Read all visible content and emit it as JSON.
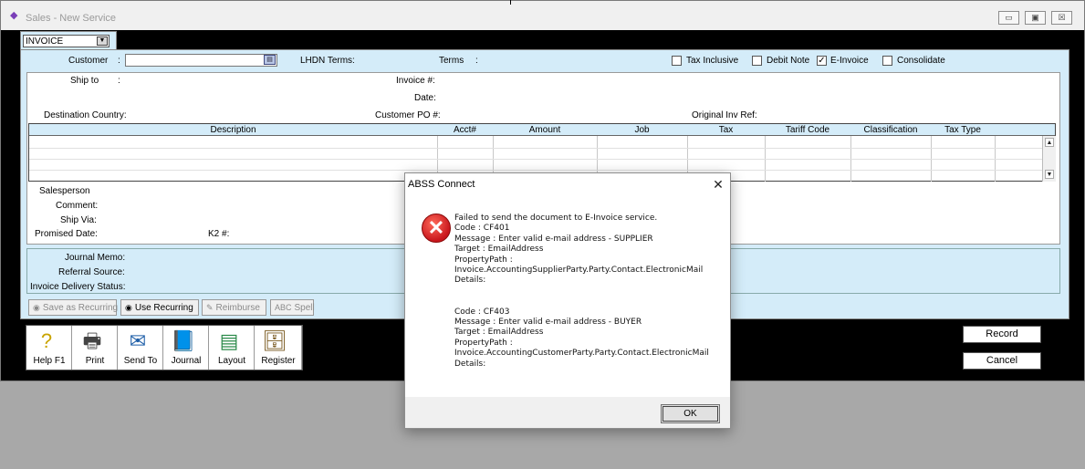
{
  "window": {
    "title": "Sales - New Service",
    "minimize": "▭",
    "maximize": "▣",
    "close": "☒"
  },
  "invoice_type": {
    "value": "INVOICE",
    "arrow": "▼"
  },
  "header": {
    "customer_label": "Customer",
    "colon": ":",
    "customer_value": "",
    "lhdn_terms_label": "LHDN Terms:",
    "terms_label": "Terms",
    "checkboxes": [
      {
        "label": "Tax Inclusive",
        "checked": false
      },
      {
        "label": "Debit Note",
        "checked": false
      },
      {
        "label": "E-Invoice",
        "checked": true
      },
      {
        "label": "Consolidate",
        "checked": false
      }
    ],
    "check_mark": "✓"
  },
  "fields": {
    "ship_to": "Ship to",
    "invoice_no": "Invoice #:",
    "date": "Date:",
    "destination_country": "Destination Country:",
    "customer_po": "Customer PO #:",
    "original_inv_ref": "Original Inv Ref:"
  },
  "grid": {
    "columns": [
      "Description",
      "Acct#",
      "Amount",
      "Job",
      "Tax",
      "Tariff Code",
      "Classification",
      "Tax Type"
    ],
    "scroll_up": "▲",
    "scroll_down": "▼"
  },
  "details": {
    "salesperson": "Salesperson",
    "comment": "Comment:",
    "ship_via": "Ship Via:",
    "promised_date": "Promised Date:",
    "k2": "K2 #:",
    "journal_memo": "Journal Memo:",
    "referral_source": "Referral Source:",
    "delivery_status": "Invoice Delivery Status:"
  },
  "action_buttons": [
    {
      "label": "Save as Recurring",
      "icon": "◉",
      "enabled": false
    },
    {
      "label": "Use Recurring",
      "icon": "◉",
      "enabled": true
    },
    {
      "label": "Reimburse",
      "icon": "✎",
      "enabled": false
    },
    {
      "label": "Spell",
      "icon": "ABC",
      "enabled": false
    }
  ],
  "toolbar": [
    {
      "label": "Help F1",
      "icon": "?",
      "icon_name": "help-icon"
    },
    {
      "label": "Print",
      "icon": "🖶",
      "icon_name": "printer-icon"
    },
    {
      "label": "Send To",
      "icon": "✉",
      "icon_name": "mailbox-icon"
    },
    {
      "label": "Journal",
      "icon": "📘",
      "icon_name": "journal-icon"
    },
    {
      "label": "Layout",
      "icon": "▤",
      "icon_name": "layout-icon"
    },
    {
      "label": "Register",
      "icon": "🗄",
      "icon_name": "register-icon"
    }
  ],
  "buttons": {
    "record": "Record",
    "cancel": "Cancel"
  },
  "dialog": {
    "title": "ABSS Connect",
    "close": "✕",
    "icon": "✕",
    "message": "Failed to send the document to E-Invoice service.\nCode : CF401\nMessage : Enter valid e-mail address - SUPPLIER\nTarget : EmailAddress\nPropertyPath :\nInvoice.AccountingSupplierParty.Party.Contact.ElectronicMail\nDetails:\n\n\nCode : CF403\nMessage : Enter valid e-mail address - BUYER\nTarget : EmailAddress\nPropertyPath :\nInvoice.AccountingCustomerParty.Party.Contact.ElectronicMail\nDetails:",
    "ok": "OK"
  },
  "colors": {
    "form_blue": "#d4ecf9",
    "error_red": "#c8161c"
  }
}
